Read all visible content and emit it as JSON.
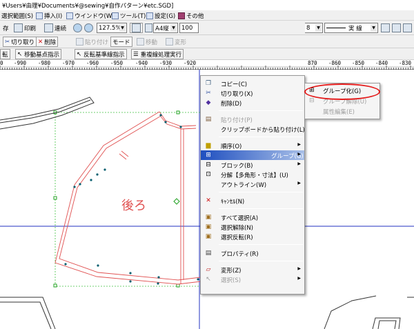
{
  "window": {
    "title": "¥Users¥由理¥Documents¥@sewing¥自作パターン¥etc.SGD]"
  },
  "menubar": {
    "items": [
      {
        "label": "選択範囲(S)"
      },
      {
        "label": "挿入(I)"
      },
      {
        "label": "ウインドウ(W)"
      },
      {
        "label": "ツール(T)"
      },
      {
        "label": "設定(G)"
      },
      {
        "label": "その他"
      }
    ]
  },
  "toolbar1": {
    "save_label": "存",
    "print_label": "印刷",
    "continuous_label": "連続",
    "zoom_value": "127.5%",
    "paper_value": "A4縦",
    "copies_value": "100",
    "line_width_value": "8",
    "line_style_value": "実 線"
  },
  "toolbar2": {
    "cut_label": "切り取り",
    "delete_label": "削除",
    "paste_label": "貼り付け",
    "mode_label": "モード",
    "move_label": "移動",
    "transform_label": "変形"
  },
  "toolbar3": {
    "rotate_label": "転",
    "move_base_label": "移動基点指示",
    "flip_base_label": "反転基準線指示",
    "overlap_label": "重複線処理実行"
  },
  "ruler": {
    "ticks": [
      "0",
      "-990",
      "-980",
      "-970",
      "-960",
      "-950",
      "-940",
      "-930",
      "-920",
      "870",
      "-860",
      "-850",
      "-840",
      "-830"
    ]
  },
  "canvas": {
    "piece_label": "後ろ"
  },
  "context_menu": {
    "items": [
      {
        "label": "コピー(C)"
      },
      {
        "label": "切り取り(X)"
      },
      {
        "label": "削除(D)"
      },
      {
        "label": "貼り付け(P)"
      },
      {
        "label": "クリップボードから貼り付け(L)"
      },
      {
        "label": "順序(O)"
      },
      {
        "label": "グループ(G)"
      },
      {
        "label": "ブロック(B)"
      },
      {
        "label": "分解【多角形・寸法】(U)"
      },
      {
        "label": "アウトライン(W)"
      },
      {
        "label": "ｷｬﾝｾﾙ(N)"
      },
      {
        "label": "すべて選択(A)"
      },
      {
        "label": "選択解除(N)"
      },
      {
        "label": "選択反転(R)"
      },
      {
        "label": "プロパティ(R)"
      },
      {
        "label": "変形(Z)"
      },
      {
        "label": "選択(S)"
      }
    ]
  },
  "submenu": {
    "items": [
      {
        "label": "グループ化(G)"
      },
      {
        "label": "グループ解除(U)"
      },
      {
        "label": "属性編集(E)"
      }
    ]
  },
  "colors": {
    "highlight": "#1f4fbf",
    "pattern_line": "#e05050",
    "guide_line": "#2030c0",
    "bbox_dash": "#40c040",
    "annotation": "#e41b1b"
  }
}
